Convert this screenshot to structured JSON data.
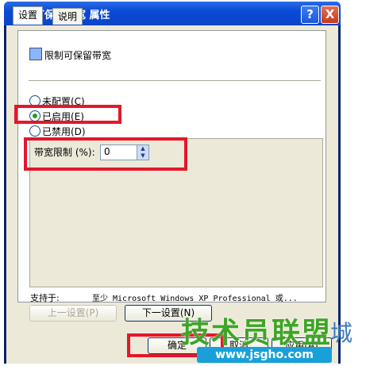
{
  "window": {
    "title": "限制可保留带宽 属性",
    "help_label": "?",
    "close_label": "X"
  },
  "tabs": [
    {
      "label": "设置"
    },
    {
      "label": "说明"
    }
  ],
  "setting": {
    "name": "限制可保留带宽"
  },
  "options": {
    "not_configured": "未配置(C)",
    "enabled": "已启用(E)",
    "disabled": "已禁用(D)",
    "selected": "enabled"
  },
  "bandwidth": {
    "label": "带宽限制 (%):",
    "value": "0"
  },
  "supported": {
    "label": "支持于:",
    "value": "至少 Microsoft Windows XP Professional 或..."
  },
  "nav": {
    "prev_label": "上一设置(P)",
    "next_label": "下一设置(N)"
  },
  "footer": {
    "ok_label": "确定",
    "cancel_label": "取消",
    "apply_label": "应用(A)"
  },
  "watermark": {
    "brand": "技术员联盟",
    "url": "www.jsgho.com",
    "suffix": "城"
  },
  "colors": {
    "highlight": "#e3172b",
    "titlebar": "#0a4ad6",
    "watermark_green": "#3ea526"
  }
}
